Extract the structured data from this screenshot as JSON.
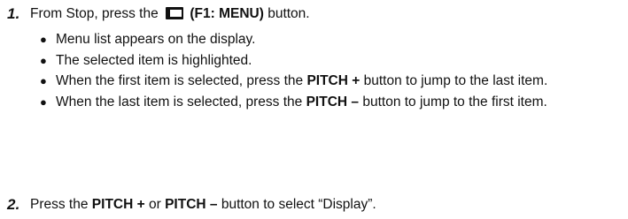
{
  "step1": {
    "number": "1.",
    "before": "From Stop, press the",
    "button_label": "(F1: MENU)",
    "after": "button."
  },
  "bullets": [
    {
      "text": "Menu list appears on the display."
    },
    {
      "text": "The selected item is highlighted."
    },
    {
      "pre": "When the first item is selected, press the",
      "key": "PITCH +",
      "post": "button to jump to the last item."
    },
    {
      "pre": "When the last item is selected, press the",
      "key": "PITCH –",
      "post": "button to jump to the first item."
    }
  ],
  "step2": {
    "number": "2.",
    "pre": "Press the",
    "key1": "PITCH +",
    "mid": "or",
    "key2": "PITCH –",
    "post": "button to select “Display”."
  },
  "icons": {
    "menu_button": "menu-button-icon"
  }
}
